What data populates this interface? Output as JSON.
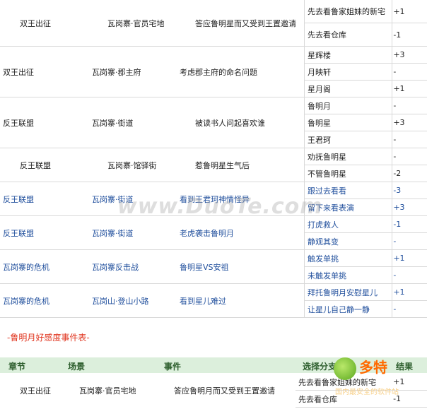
{
  "rows": [
    {
      "chapter": "双王出征",
      "scene": "瓦岗寨·官员宅地",
      "event": "答应鲁明星而又受到王置邀请",
      "blue": false,
      "options": [
        {
          "label": "先去看鲁家姐妹的新宅",
          "value": "+1"
        },
        {
          "label": "先去看仓库",
          "value": "-1"
        }
      ]
    },
    {
      "chapter": "双王出征",
      "scene": "瓦岗寨·郡主府",
      "event": "考虑郡主府的命名问题",
      "blue": false,
      "options": [
        {
          "label": "星辉楼",
          "value": "+3"
        },
        {
          "label": "月映轩",
          "value": "-"
        },
        {
          "label": "星月阁",
          "value": "+1"
        }
      ]
    },
    {
      "chapter": "反王联盟",
      "scene": "瓦岗寨·街道",
      "event": "被读书人问起喜欢谁",
      "blue": false,
      "options": [
        {
          "label": "鲁明月",
          "value": "-"
        },
        {
          "label": "鲁明星",
          "value": "+3"
        },
        {
          "label": "王君珂",
          "value": "-"
        }
      ]
    },
    {
      "chapter": "反王联盟",
      "scene": "瓦岗寨·馆驿街",
      "event": "惹鲁明星生气后",
      "blue": false,
      "options": [
        {
          "label": "劝抚鲁明星",
          "value": "-"
        },
        {
          "label": "不管鲁明星",
          "value": "-2"
        }
      ]
    },
    {
      "chapter": "反王联盟",
      "scene": "瓦岗寨·街道",
      "event": "看到王君珂神情怪异",
      "blue": true,
      "options": [
        {
          "label": "跟过去看看",
          "value": "-3"
        },
        {
          "label": "留下来看表演",
          "value": "+3"
        }
      ]
    },
    {
      "chapter": "反王联盟",
      "scene": "瓦岗寨·街道",
      "event": "老虎袭击鲁明月",
      "blue": true,
      "options": [
        {
          "label": "打虎救人",
          "value": "-1"
        },
        {
          "label": "静观其变",
          "value": "-"
        }
      ]
    },
    {
      "chapter": "瓦岗寨的危机",
      "scene": "瓦岗寨反击战",
      "event": "鲁明星VS安祖",
      "blue": true,
      "options": [
        {
          "label": "触发单挑",
          "value": "+1"
        },
        {
          "label": "未触发单挑",
          "value": "-"
        }
      ]
    },
    {
      "chapter": "瓦岗寨的危机",
      "scene": "瓦岗山·登山小路",
      "event": "看到星儿难过",
      "blue": true,
      "options": [
        {
          "label": "拜托鲁明月安慰星儿",
          "value": "+1"
        },
        {
          "label": "让星儿自己静一静",
          "value": "-"
        }
      ]
    }
  ],
  "section_title": "-鲁明月好感度事件表-",
  "header": {
    "chapter": "章节",
    "scene": "场景",
    "event": "事件",
    "choice": "选择分支",
    "result": "结果"
  },
  "bottom_row": {
    "chapter": "双王出征",
    "scene": "瓦岗寨·官员宅地",
    "event": "答应鲁明月而又受到王置邀请",
    "options": [
      {
        "label": "先去看鲁家姐妹的新宅",
        "value": "+1"
      },
      {
        "label": "先去看仓库",
        "value": "-1"
      }
    ]
  },
  "watermark": "www.DuoTe.com",
  "logo": {
    "name": "多特",
    "tagline": "国内最安全的软件站"
  }
}
